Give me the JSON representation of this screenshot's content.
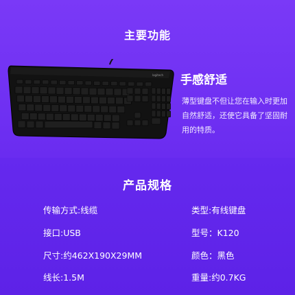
{
  "features": {
    "title": "主要功能",
    "comfort_title": "手感舒适",
    "comfort_desc": "薄型键盘不但让您在输入时更加自然舒适，还使它具备了坚固耐用的特质。",
    "keyboard_brand_text": "logitech"
  },
  "specs": {
    "title": "产品规格",
    "items": [
      {
        "text": "传输方式:线缆"
      },
      {
        "text": "类型:有线键盘"
      },
      {
        "text": "接口:USB"
      },
      {
        "text": "型号：K120"
      },
      {
        "text": "尺寸:约462X190X29MM"
      },
      {
        "text": "颜色：黑色"
      },
      {
        "text": "线长:1.5M"
      },
      {
        "text": "重量:约0.7KG"
      }
    ]
  },
  "colors": {
    "background": "#6b2ff2",
    "keyboard_body": "#121212",
    "key": "#1e1e1e",
    "key_text": "#bdbdbd"
  }
}
